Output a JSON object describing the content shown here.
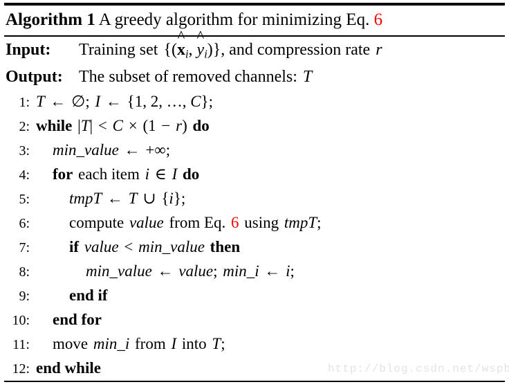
{
  "algorithm": {
    "title": {
      "keyword": "Algorithm 1",
      "caption_pre": "A greedy algorithm for minimizing Eq.",
      "eq_ref": "6"
    },
    "io": [
      {
        "label": "Input:",
        "text_parts": {
          "lead": "Training set",
          "set_open": "{(",
          "x_hat": "x",
          "x_sub": "i",
          "comma": ",",
          "y_hat": "y",
          "y_sub": "i",
          "set_close": ")}",
          "tail": ", and compression rate",
          "rate_var": "r"
        }
      },
      {
        "label": "Output:",
        "text_parts": {
          "lead": "The subset of removed channels:",
          "var": "T"
        }
      }
    ],
    "steps": [
      {
        "num": "1:",
        "indent": 0,
        "plain": "T ← ∅; I ← {1, 2, … , C};",
        "tokens": {
          "t": "T",
          "arrow1": "←",
          "empty": "∅",
          "semi1": ";",
          "i": "I",
          "arrow2": "←",
          "brace_open": "{",
          "one": "1",
          "c1": ",",
          "two": "2",
          "c2": ",",
          "dots": "…",
          "c3": ",",
          "cvar": "C",
          "brace_close": "}",
          "semi2": ";"
        }
      },
      {
        "num": "2:",
        "indent": 0,
        "plain": "while |T| < C × (1 − r) do",
        "tokens": {
          "kw_while": "while",
          "bar1": "|",
          "t": "T",
          "bar2": "|",
          "lt": "<",
          "cvar": "C",
          "times": "×",
          "paren_open": "(",
          "one": "1",
          "minus": "−",
          "rvar": "r",
          "paren_close": ")",
          "kw_do": "do"
        }
      },
      {
        "num": "3:",
        "indent": 1,
        "plain": "min_value ← +∞;",
        "tokens": {
          "var": "min_value",
          "arrow": "←",
          "plus": "+",
          "inf": "∞",
          "semi": ";"
        }
      },
      {
        "num": "4:",
        "indent": 1,
        "plain": "for each item i ∈ I do",
        "tokens": {
          "kw_for": "for",
          "lead": "each item",
          "ivar": "i",
          "in": "∈",
          "iset": "I",
          "kw_do": "do"
        }
      },
      {
        "num": "5:",
        "indent": 2,
        "plain": "tmpT ← T ∪ {i};",
        "tokens": {
          "tmp": "tmpT",
          "arrow": "←",
          "t": "T",
          "cup": "∪",
          "brace_open": "{",
          "ivar": "i",
          "brace_close": "}",
          "semi": ";"
        }
      },
      {
        "num": "6:",
        "indent": 2,
        "plain": "compute value from Eq. 6 using tmpT;",
        "tokens": {
          "lead": "compute",
          "value": "value",
          "mid": "from Eq.",
          "eq_ref": "6",
          "using": "using",
          "tmp": "tmpT",
          "semi": ";"
        }
      },
      {
        "num": "7:",
        "indent": 2,
        "plain": "if value < min_value then",
        "tokens": {
          "kw_if": "if",
          "value": "value",
          "lt": "<",
          "minvalue": "min_value",
          "kw_then": "then"
        }
      },
      {
        "num": "8:",
        "indent": 3,
        "plain": "min_value ← value; min_i ← i;",
        "tokens": {
          "minvalue": "min_value",
          "arrow1": "←",
          "value": "value",
          "semi1": ";",
          "mini": "min_i",
          "arrow2": "←",
          "ivar": "i",
          "semi2": ";"
        }
      },
      {
        "num": "9:",
        "indent": 2,
        "plain": "end if",
        "tokens": {
          "kw": "end if"
        }
      },
      {
        "num": "10:",
        "indent": 1,
        "plain": "end for",
        "tokens": {
          "kw": "end for"
        }
      },
      {
        "num": "11:",
        "indent": 1,
        "plain": "move min_i from I into T;",
        "tokens": {
          "lead": "move",
          "mini": "min_i",
          "from": "from",
          "iset": "I",
          "into": "into",
          "t": "T",
          "semi": ";"
        }
      },
      {
        "num": "12:",
        "indent": 0,
        "plain": "end while",
        "tokens": {
          "kw": "end while"
        }
      }
    ]
  },
  "watermark": {
    "text": "http://blog.csdn.net/wspba"
  },
  "colors": {
    "eq_ref": "#ff0000",
    "text": "#000000",
    "background": "#ffffff",
    "watermark": "#e3e3e3"
  }
}
